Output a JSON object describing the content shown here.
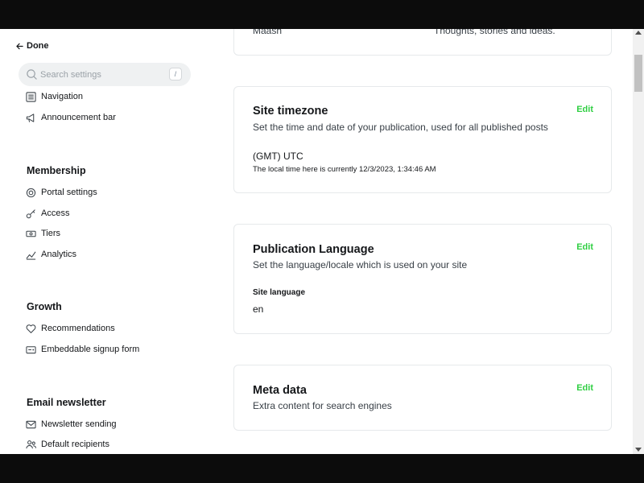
{
  "sidebar": {
    "done_label": "Done",
    "search": {
      "placeholder": "Search settings",
      "shortcut": "/"
    },
    "site_items": [
      {
        "label": "Navigation",
        "icon": "navigation-icon"
      },
      {
        "label": "Announcement bar",
        "icon": "megaphone-icon"
      }
    ],
    "membership": {
      "title": "Membership",
      "items": [
        {
          "label": "Portal settings",
          "icon": "portal-icon"
        },
        {
          "label": "Access",
          "icon": "key-icon"
        },
        {
          "label": "Tiers",
          "icon": "ticket-icon"
        },
        {
          "label": "Analytics",
          "icon": "chart-icon"
        }
      ]
    },
    "growth": {
      "title": "Growth",
      "items": [
        {
          "label": "Recommendations",
          "icon": "heart-icon"
        },
        {
          "label": "Embeddable signup form",
          "icon": "form-icon"
        }
      ]
    },
    "email": {
      "title": "Email newsletter",
      "items": [
        {
          "label": "Newsletter sending",
          "icon": "mail-icon"
        },
        {
          "label": "Default recipients",
          "icon": "users-icon"
        }
      ]
    }
  },
  "main": {
    "partial_card": {
      "left_text": "Maash",
      "right_text": "Thoughts, stories and ideas."
    },
    "timezone": {
      "title": "Site timezone",
      "description": "Set the time and date of your publication, used for all published posts",
      "value": "(GMT) UTC",
      "local_time": "The local time here is currently 12/3/2023, 1:34:46 AM",
      "edit_label": "Edit"
    },
    "language": {
      "title": "Publication Language",
      "description": "Set the language/locale which is used on your site",
      "field_label": "Site language",
      "value": "en",
      "edit_label": "Edit"
    },
    "meta": {
      "title": "Meta data",
      "description": "Extra content for search engines",
      "edit_label": "Edit"
    }
  },
  "colors": {
    "accent_green": "#30cf43",
    "text": "#15171a",
    "border": "#e6e9eb"
  }
}
